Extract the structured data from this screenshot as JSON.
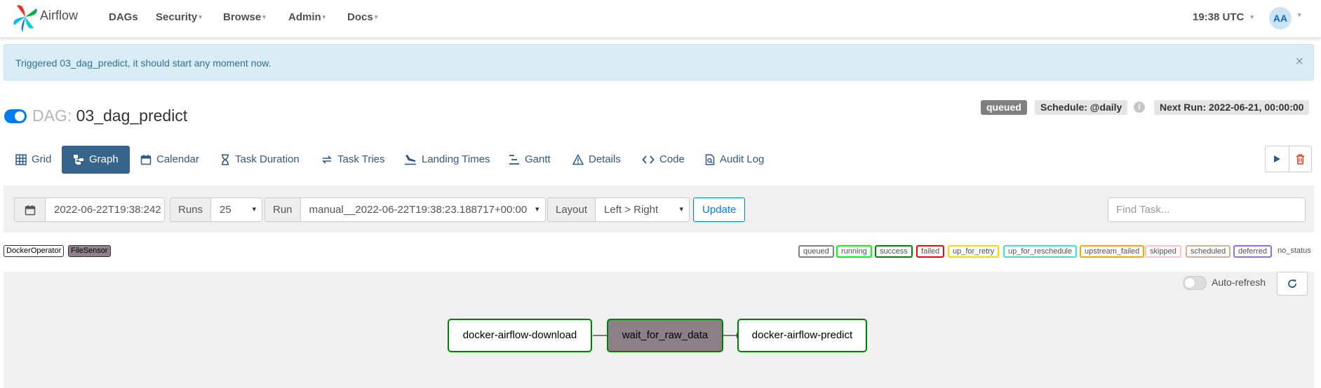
{
  "navbar": {
    "brand": "Airflow",
    "items": [
      {
        "label": "DAGs"
      },
      {
        "label": "Security"
      },
      {
        "label": "Browse"
      },
      {
        "label": "Admin"
      },
      {
        "label": "Docs"
      }
    ],
    "caret": "▾",
    "time": "19:38 UTC",
    "avatar": "AA"
  },
  "alert": {
    "message": "Triggered 03_dag_predict, it should start any moment now.",
    "close": "×"
  },
  "dag": {
    "prefix": "DAG:",
    "name": "03_dag_predict",
    "state_badge": "queued",
    "schedule": "Schedule: @daily",
    "info": "i",
    "next_run": "Next Run: 2022-06-21, 00:00:00"
  },
  "tabs": [
    {
      "label": "Grid",
      "icon": "grid-icon"
    },
    {
      "label": "Graph",
      "icon": "graph-icon"
    },
    {
      "label": "Calendar",
      "icon": "calendar-icon"
    },
    {
      "label": "Task Duration",
      "icon": "hourglass-icon"
    },
    {
      "label": "Task Tries",
      "icon": "retry-icon"
    },
    {
      "label": "Landing Times",
      "icon": "plane-landing-icon"
    },
    {
      "label": "Gantt",
      "icon": "gantt-icon"
    },
    {
      "label": "Details",
      "icon": "warning-triangle-icon"
    },
    {
      "label": "Code",
      "icon": "code-icon"
    },
    {
      "label": "Audit Log",
      "icon": "file-search-icon"
    }
  ],
  "filters": {
    "date_value": "2022-06-22T19:38:242",
    "runs_label": "Runs",
    "runs_value": "25",
    "run_label": "Run",
    "run_value": "manual__2022-06-22T19:38:23.188717+00:00",
    "layout_label": "Layout",
    "layout_value": "Left > Right",
    "update_label": "Update",
    "find_placeholder": "Find Task..."
  },
  "operators": [
    {
      "label": "DockerOperator",
      "color": "#ffffff"
    },
    {
      "label": "FileSensor",
      "color": "#91818a"
    }
  ],
  "states": [
    {
      "label": "queued",
      "color": "#808080"
    },
    {
      "label": "running",
      "color": "#00ff00"
    },
    {
      "label": "success",
      "color": "#008000"
    },
    {
      "label": "failed",
      "color": "#ff0000"
    },
    {
      "label": "up_for_retry",
      "color": "#ffd700"
    },
    {
      "label": "up_for_reschedule",
      "color": "#40e0d0"
    },
    {
      "label": "upstream_failed",
      "color": "#ffa500"
    },
    {
      "label": "skipped",
      "color": "#ffc0cb"
    },
    {
      "label": "scheduled",
      "color": "#d2b48c"
    },
    {
      "label": "deferred",
      "color": "#9370db"
    }
  ],
  "no_status_label": "no_status",
  "graph": {
    "autorefresh_label": "Auto-refresh",
    "nodes": [
      {
        "label": "docker-airflow-download"
      },
      {
        "label": "wait_for_raw_data"
      },
      {
        "label": "docker-airflow-predict"
      }
    ]
  }
}
